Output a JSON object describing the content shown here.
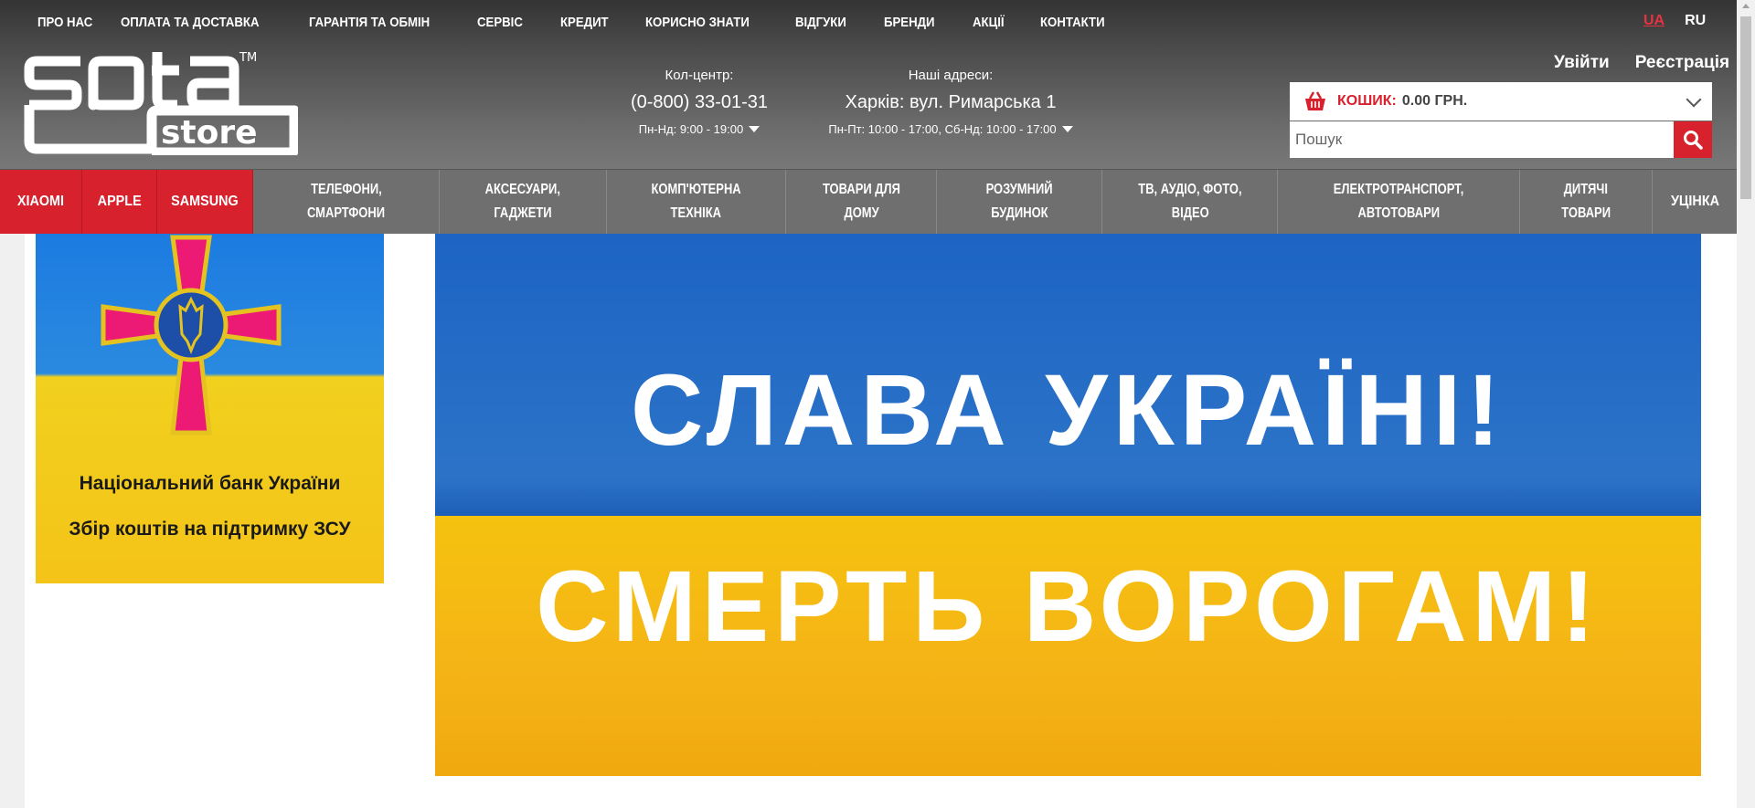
{
  "topnav": [
    "ПРО НАС",
    "ОПЛАТА ТА ДОСТАВКА",
    "ГАРАНТІЯ ТА ОБМІН",
    "СЕРВІС",
    "КРЕДИТ",
    "КОРИСНО ЗНАТИ",
    "ВІДГУКИ",
    "БРЕНДИ",
    "АКЦІЇ",
    "КОНТАКТИ"
  ],
  "lang": {
    "ua": "UA",
    "ru": "RU"
  },
  "logo": {
    "main": "sota",
    "sub": "store",
    "tm": "TM"
  },
  "callcenter": {
    "label": "Кол-центр:",
    "phone": "(0-800) 33-01-31",
    "hours": "Пн-Нд: 9:00 - 19:00"
  },
  "addresses": {
    "label": "Наші адреси:",
    "address": "Харків: вул. Римарська 1",
    "hours": "Пн-Пт: 10:00 - 17:00, Сб-Нд: 10:00 - 17:00"
  },
  "auth": {
    "login": "Увійти",
    "register": "Реєстрація"
  },
  "cart": {
    "label": "КОШИК:",
    "total": "0.00 ГРН."
  },
  "search": {
    "placeholder": "Пошук"
  },
  "categories": [
    {
      "line1": "XIAOMI",
      "line2": ""
    },
    {
      "line1": "APPLE",
      "line2": ""
    },
    {
      "line1": "SAMSUNG",
      "line2": ""
    },
    {
      "line1": "ТЕЛЕФОНИ,",
      "line2": "СМАРТФОНИ"
    },
    {
      "line1": "АКСЕСУАРИ,",
      "line2": "ГАДЖЕТИ"
    },
    {
      "line1": "КОМП'ЮТЕРНА",
      "line2": "ТЕХНІКА"
    },
    {
      "line1": "ТОВАРИ ДЛЯ",
      "line2": "ДОМУ"
    },
    {
      "line1": "РОЗУМНИЙ",
      "line2": "БУДИНОК"
    },
    {
      "line1": "ТВ, АУДІО, ФОТО,",
      "line2": "ВІДЕО"
    },
    {
      "line1": "ЕЛЕКТРОТРАНСПОРТ,",
      "line2": "АВТОТОВАРИ"
    },
    {
      "line1": "ДИТЯЧІ",
      "line2": "ТОВАРИ"
    },
    {
      "line1": "УЦІНКА",
      "line2": ""
    }
  ],
  "left_banner": {
    "line1": "Національний банк України",
    "line2": "Збір коштів на підтримку ЗСУ"
  },
  "main_banner": {
    "line1": "СЛАВА УКРАЇНІ!",
    "line2": "СМЕРТЬ ВОРОГАМ!"
  },
  "colors": {
    "accent": "#d7212d",
    "flag_blue": "#1d64c4",
    "flag_yellow": "#f5c20f"
  }
}
